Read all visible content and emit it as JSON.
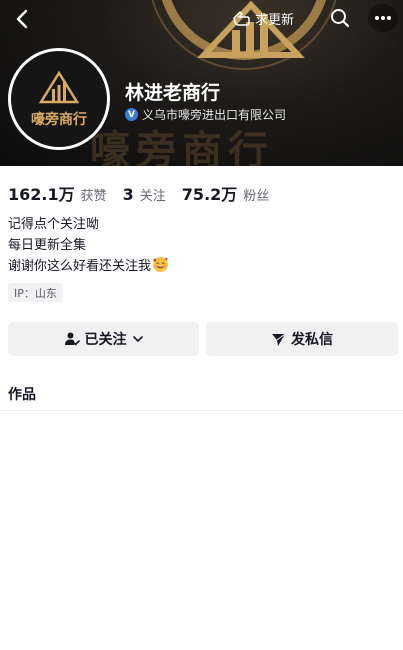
{
  "topbar": {
    "follow_update_label": "求更新"
  },
  "profile": {
    "avatar_text": "嚎旁商行",
    "name": "林进老商行",
    "verified_company": "义乌市嚎旁进出口有限公司",
    "verified_badge": "V"
  },
  "stats": [
    {
      "value": "162.1万",
      "label": "获赞"
    },
    {
      "value": "3",
      "label": "关注"
    },
    {
      "value": "75.2万",
      "label": "粉丝"
    }
  ],
  "bio": {
    "line1": "记得点个关注呦",
    "line2": "每日更新全集",
    "line3": "谢谢你这么好看还关注我"
  },
  "ip_tag": "IP：山东",
  "actions": {
    "followed_label": "已关注",
    "message_label": "发私信"
  },
  "tabs": {
    "works_label": "作品"
  },
  "colors": {
    "accent_gold": "#d9a962",
    "verified_blue": "#3a7bd5",
    "button_bg": "#f1f1f2"
  },
  "icons": {
    "back": "chevron-left-icon",
    "follow_update": "hand-icon",
    "search": "search-icon",
    "more": "more-dots-icon",
    "followed": "user-check-icon",
    "dropdown": "chevron-down-icon",
    "message": "paper-plane-icon"
  }
}
